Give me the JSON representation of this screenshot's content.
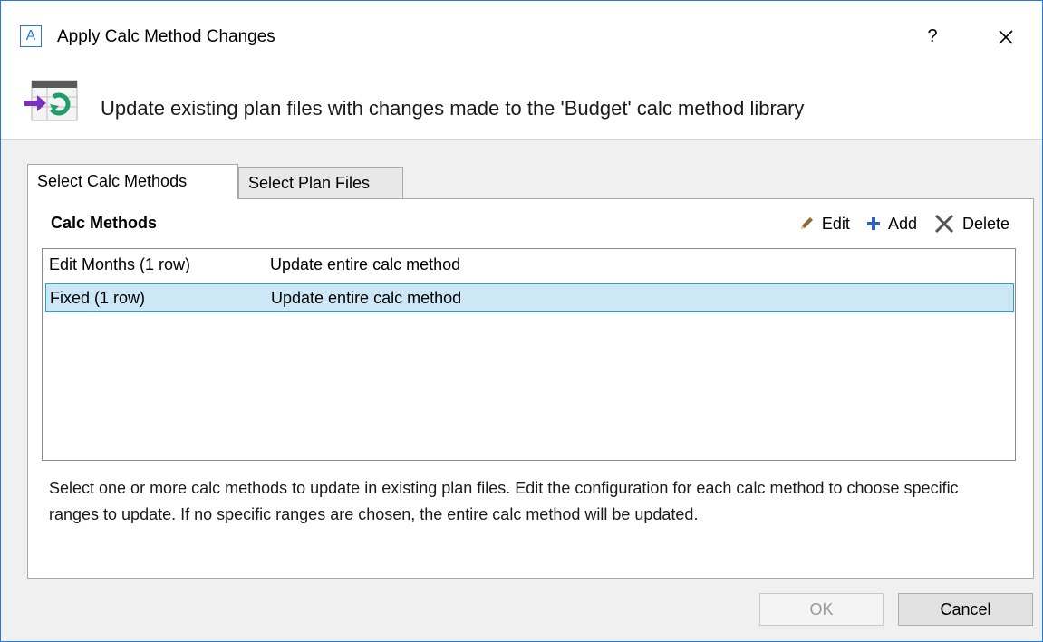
{
  "window": {
    "app_icon_letter": "A",
    "title": "Apply Calc Method Changes",
    "help_label": "?"
  },
  "header": {
    "text": "Update existing plan files with changes made to the 'Budget' calc method library"
  },
  "tabs": [
    {
      "label": "Select Calc Methods",
      "active": true
    },
    {
      "label": "Select Plan Files",
      "active": false
    }
  ],
  "section": {
    "title": "Calc Methods",
    "toolbar": {
      "edit_label": "Edit",
      "add_label": "Add",
      "delete_label": "Delete"
    }
  },
  "list": {
    "rows": [
      {
        "name": "Edit Months (1 row)",
        "action": "Update entire calc method",
        "selected": false
      },
      {
        "name": "Fixed (1 row)",
        "action": "Update entire calc method",
        "selected": true
      }
    ]
  },
  "note": "Select one or more calc methods to update in existing plan files. Edit the configuration for each calc method to choose specific ranges to update. If no specific ranges are chosen, the entire calc method will be updated.",
  "buttons": {
    "ok_label": "OK",
    "ok_enabled": false,
    "cancel_label": "Cancel"
  },
  "colors": {
    "accent": "#2b79d7",
    "selection_bg": "#cce8f6",
    "selection_border": "#26a0da"
  }
}
